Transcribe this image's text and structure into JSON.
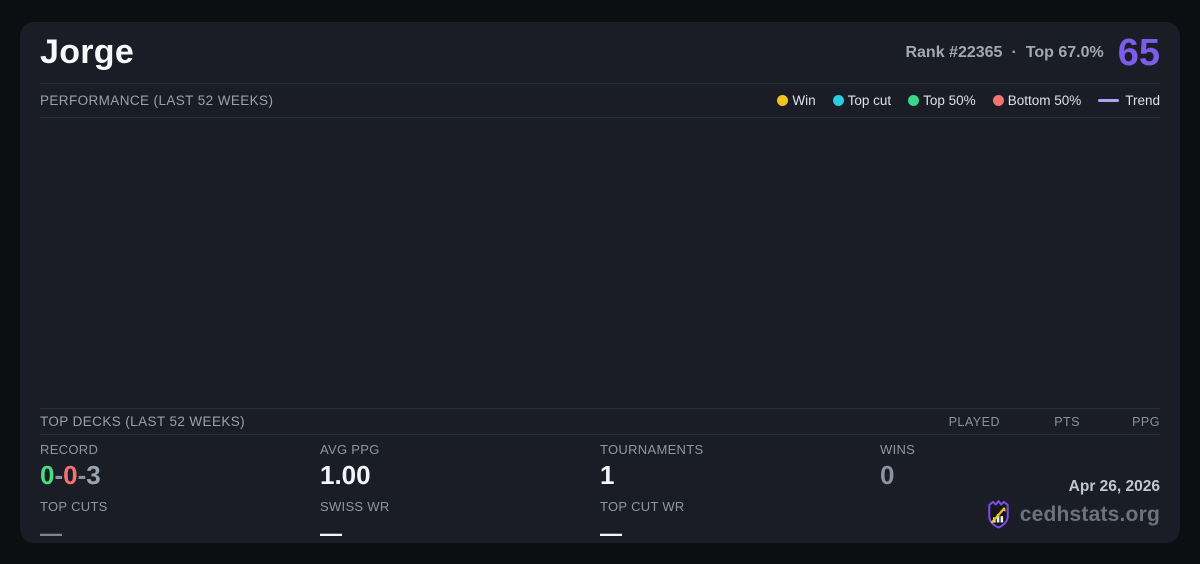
{
  "page": {
    "background_color": "#0d0e11",
    "card_background_color": "#1a1d26"
  },
  "header": {
    "player_name": "Jorge",
    "rank_label": "Rank #22365",
    "separator": "·",
    "percentile_label": "Top 67.0%",
    "score": "65",
    "score_color": "#7c5ce8"
  },
  "performance": {
    "title": "PERFORMANCE (LAST 52 WEEKS)",
    "chart_empty": true,
    "legend": {
      "items": [
        {
          "label": "Win",
          "color": "#f0c41f"
        },
        {
          "label": "Top cut",
          "color": "#29cde4"
        },
        {
          "label": "Top 50%",
          "color": "#3bd689"
        },
        {
          "label": "Bottom 50%",
          "color": "#f37373"
        }
      ],
      "trend": {
        "label": "Trend",
        "color": "#b0a3f5"
      }
    }
  },
  "top_decks": {
    "title": "TOP DECKS (LAST 52 WEEKS)",
    "columns": [
      "PLAYED",
      "PTS",
      "PPG"
    ],
    "rows": []
  },
  "stats": {
    "record": {
      "label": "RECORD",
      "wins": "0",
      "losses": "0",
      "draws": "3",
      "separator": "-",
      "wins_color": "#4ade80",
      "losses_color": "#f87171",
      "draws_color": "#9aa3b0"
    },
    "avg_ppg": {
      "label": "AVG PPG",
      "value": "1.00"
    },
    "tournaments": {
      "label": "TOURNAMENTS",
      "value": "1"
    },
    "wins": {
      "label": "WINS",
      "value": "0"
    },
    "top_cuts": {
      "label": "TOP CUTS",
      "value": "—"
    },
    "swiss_wr": {
      "label": "SWISS WR",
      "value": "—"
    },
    "top_cut_wr": {
      "label": "TOP CUT WR",
      "value": "—"
    }
  },
  "footer": {
    "date": "Apr 26, 2026",
    "brand": "cedhstats.org",
    "logo_colors": {
      "shield": "#7c4fe0",
      "bars": "#f2f4f7",
      "arrow": "#f0c41f"
    }
  }
}
